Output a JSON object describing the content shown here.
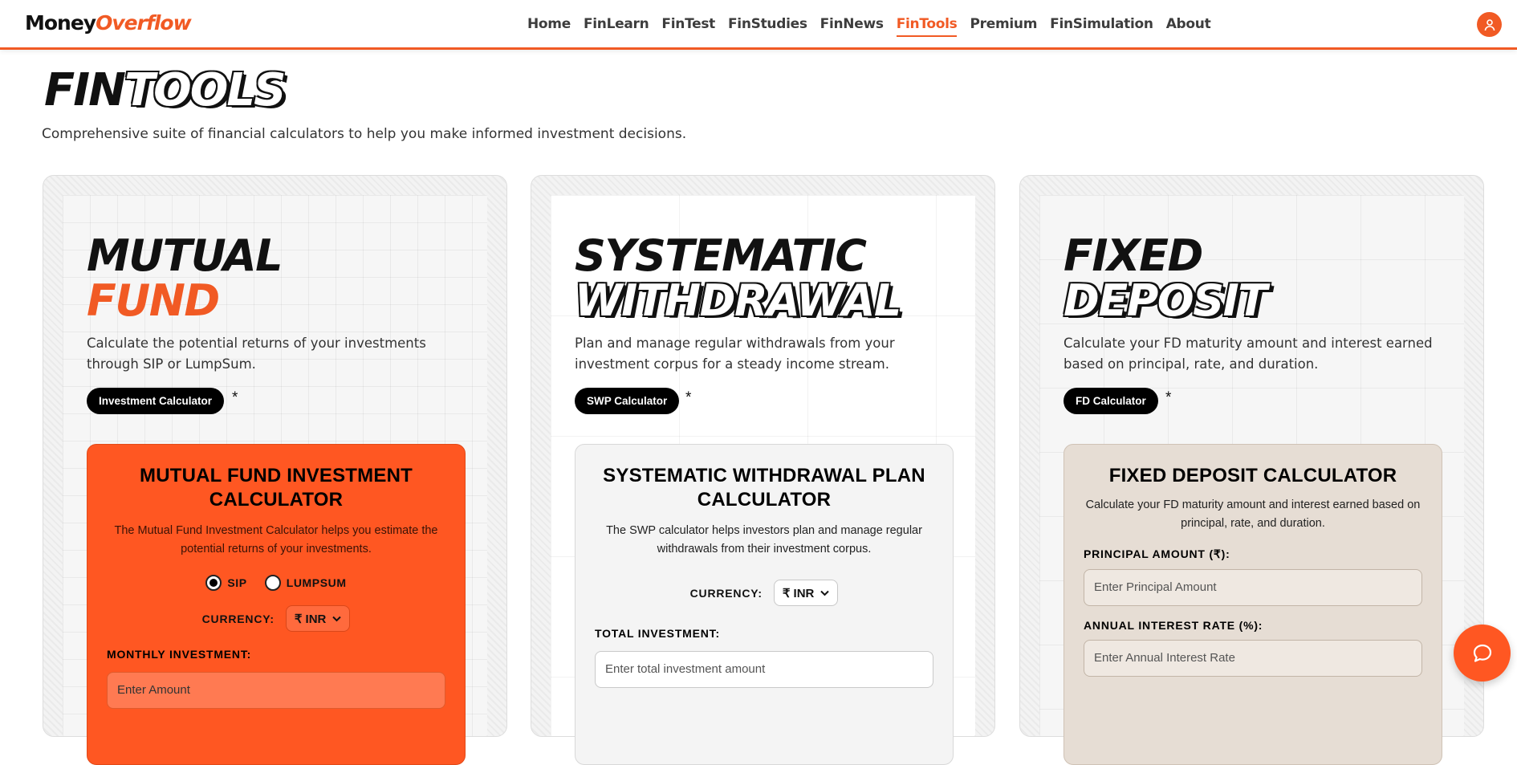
{
  "header": {
    "logo_main": "Money",
    "logo_accent": "Overflow",
    "nav": [
      "Home",
      "FinLearn",
      "FinTest",
      "FinStudies",
      "FinNews",
      "FinTools",
      "Premium",
      "FinSimulation",
      "About"
    ],
    "active_nav": "FinTools",
    "icons": {
      "user": "user-icon"
    }
  },
  "page": {
    "title_part1": "FIN",
    "title_part2": "TOOLS",
    "subtitle": "Comprehensive suite of financial calculators to help you make informed investment decisions."
  },
  "cards": [
    {
      "title_line1": "MUTUAL",
      "title_line2": "FUND",
      "description": "Calculate the potential returns of your investments through SIP or LumpSum.",
      "pill": "Investment Calculator",
      "asterisk": "*",
      "calculator": {
        "heading": "MUTUAL FUND INVESTMENT CALCULATOR",
        "description": "The Mutual Fund Investment Calculator helps you estimate the potential returns of your investments.",
        "radio_sip": "SIP",
        "radio_lumpsum": "LUMPSUM",
        "currency_label": "CURRENCY:",
        "currency_value": "₹ INR",
        "field_label": "MONTHLY INVESTMENT:",
        "field_placeholder": "Enter Amount"
      }
    },
    {
      "title_line1": "SYSTEMATIC",
      "title_line2": "WITHDRAWAL",
      "description": "Plan and manage regular withdrawals from your investment corpus for a steady income stream.",
      "pill": "SWP Calculator",
      "asterisk": "*",
      "calculator": {
        "heading": "SYSTEMATIC WITHDRAWAL PLAN CALCULATOR",
        "description": "The SWP calculator helps investors plan and manage regular withdrawals from their investment corpus.",
        "currency_label": "CURRENCY:",
        "currency_value": "₹ INR",
        "field_label": "TOTAL INVESTMENT:",
        "field_placeholder": "Enter total investment amount"
      }
    },
    {
      "title_line1": "FIXED",
      "title_line2": "DEPOSIT",
      "description": "Calculate your FD maturity amount and interest earned based on principal, rate, and duration.",
      "pill": "FD Calculator",
      "asterisk": "*",
      "calculator": {
        "heading": "FIXED DEPOSIT CALCULATOR",
        "description": "Calculate your FD maturity amount and interest earned based on principal, rate, and duration.",
        "field1_label": "PRINCIPAL AMOUNT (₹):",
        "field1_placeholder": "Enter Principal Amount",
        "field2_label": "ANNUAL INTEREST RATE (%):",
        "field2_placeholder": "Enter Annual Interest Rate"
      }
    }
  ],
  "colors": {
    "accent": "#f15a24",
    "orange_card": "#ff5722",
    "tan_card": "#e6ddd4"
  },
  "chat": {
    "icon": "chat-icon"
  }
}
